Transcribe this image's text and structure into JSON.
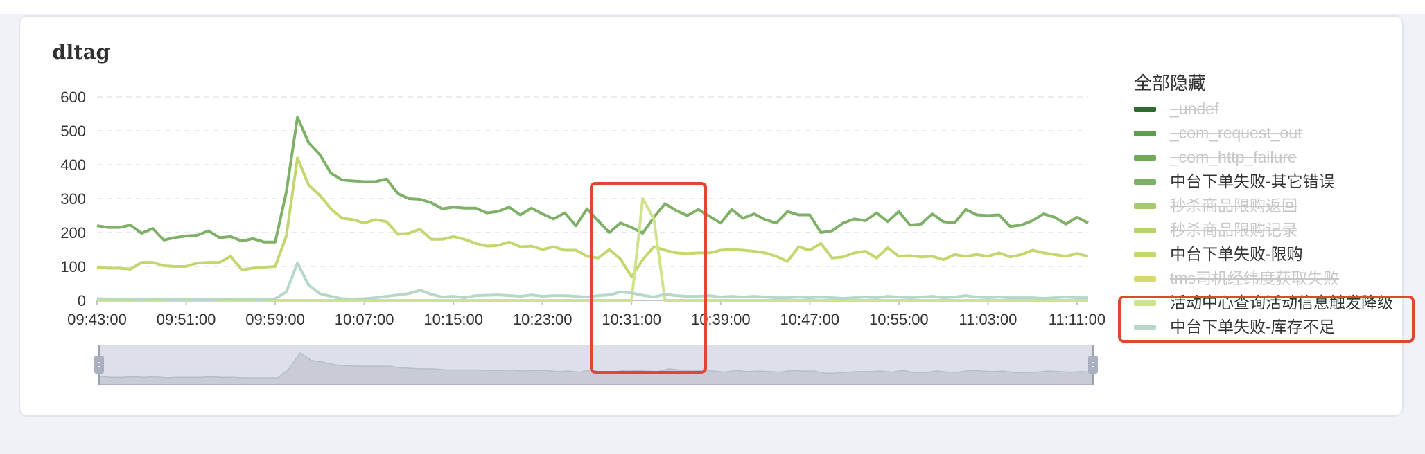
{
  "chart_data": {
    "type": "line",
    "title": "dltag",
    "xlabel": "",
    "ylabel": "",
    "ylim": [
      0,
      600
    ],
    "y_ticks": [
      0,
      100,
      200,
      300,
      400,
      500,
      600
    ],
    "grid": "horizontal dashed",
    "legend_position": "right",
    "legend_toggle_label": "全部隐藏",
    "x_tick_labels": [
      "09:43:00",
      "09:51:00",
      "09:59:00",
      "10:07:00",
      "10:15:00",
      "10:23:00",
      "10:31:00",
      "10:39:00",
      "10:47:00",
      "10:55:00",
      "11:03:00",
      "11:11:00"
    ],
    "x_tick_minutes": [
      0,
      8,
      16,
      24,
      32,
      40,
      48,
      56,
      64,
      72,
      80,
      88
    ],
    "x_range_minutes": [
      0,
      89
    ],
    "series": [
      {
        "name": "_undef",
        "color": "#2e6b2e",
        "visible": false,
        "values": []
      },
      {
        "name": "_com_request_out",
        "color": "#5b9e4c",
        "visible": false,
        "values": []
      },
      {
        "name": "_com_http_failure",
        "color": "#6eaa58",
        "visible": false,
        "values": []
      },
      {
        "name": "中台下单失败-其它错误",
        "color": "#7eb167",
        "visible": true,
        "values": [
          220,
          215,
          215,
          222,
          198,
          212,
          178,
          185,
          190,
          192,
          205,
          185,
          188,
          175,
          182,
          172,
          172,
          320,
          540,
          465,
          430,
          375,
          355,
          352,
          350,
          350,
          358,
          315,
          300,
          298,
          288,
          270,
          275,
          272,
          272,
          258,
          262,
          275,
          252,
          272,
          255,
          240,
          258,
          220,
          270,
          235,
          200,
          228,
          215,
          198,
          245,
          285,
          265,
          250,
          268,
          248,
          228,
          268,
          242,
          255,
          238,
          228,
          262,
          252,
          252,
          200,
          205,
          228,
          240,
          235,
          258,
          232,
          262,
          222,
          225,
          255,
          232,
          228,
          268,
          252,
          250,
          252,
          218,
          222,
          235,
          255,
          245,
          225,
          245,
          228
        ]
      },
      {
        "name": "秒杀商品限购返回",
        "color": "#a6c86e",
        "visible": false,
        "values": []
      },
      {
        "name": "秒杀商品限购记录",
        "color": "#b6d370",
        "visible": false,
        "values": []
      },
      {
        "name": "中台下单失败-限购",
        "color": "#c2d86e",
        "visible": true,
        "values": [
          98,
          95,
          95,
          92,
          112,
          112,
          102,
          100,
          100,
          110,
          112,
          112,
          130,
          90,
          95,
          98,
          100,
          190,
          420,
          340,
          310,
          270,
          242,
          238,
          228,
          238,
          232,
          195,
          198,
          210,
          180,
          180,
          188,
          180,
          168,
          160,
          162,
          172,
          158,
          160,
          150,
          158,
          148,
          148,
          130,
          125,
          150,
          122,
          70,
          120,
          158,
          148,
          140,
          138,
          140,
          140,
          148,
          150,
          148,
          145,
          140,
          130,
          115,
          158,
          148,
          168,
          125,
          128,
          140,
          145,
          125,
          155,
          130,
          132,
          128,
          130,
          120,
          135,
          130,
          135,
          130,
          140,
          128,
          135,
          148,
          140,
          135,
          130,
          138,
          130
        ]
      },
      {
        "name": "tms司机经纬度获取失败",
        "color": "#d6d972",
        "visible": false,
        "values": []
      },
      {
        "name": "活动中心查询活动信息触发降级",
        "color": "#cfe28c",
        "visible": true,
        "values": [
          0,
          0,
          0,
          0,
          0,
          0,
          0,
          0,
          0,
          0,
          0,
          0,
          0,
          0,
          0,
          0,
          0,
          0,
          0,
          0,
          0,
          0,
          0,
          0,
          0,
          0,
          0,
          0,
          0,
          0,
          0,
          0,
          0,
          0,
          0,
          0,
          0,
          0,
          0,
          0,
          0,
          0,
          0,
          0,
          0,
          0,
          0,
          0,
          0,
          300,
          240,
          0,
          0,
          0,
          0,
          0,
          0,
          0,
          0,
          0,
          0,
          0,
          0,
          0,
          0,
          0,
          0,
          0,
          0,
          0,
          0,
          0,
          0,
          0,
          0,
          0,
          0,
          0,
          0,
          0,
          0,
          0,
          0,
          0,
          0,
          0,
          0,
          0,
          0,
          0
        ]
      },
      {
        "name": "中台下单失败-库存不足",
        "color": "#b6d8c8",
        "visible": true,
        "values": [
          5,
          4,
          3,
          4,
          2,
          4,
          3,
          2,
          3,
          2,
          2,
          3,
          4,
          3,
          3,
          2,
          5,
          25,
          110,
          45,
          20,
          12,
          5,
          4,
          5,
          8,
          12,
          16,
          20,
          30,
          18,
          10,
          12,
          8,
          14,
          15,
          16,
          14,
          12,
          16,
          12,
          14,
          14,
          12,
          10,
          14,
          16,
          25,
          22,
          15,
          10,
          18,
          14,
          12,
          12,
          14,
          10,
          12,
          10,
          12,
          10,
          8,
          8,
          10,
          8,
          10,
          8,
          6,
          8,
          10,
          8,
          12,
          10,
          8,
          10,
          12,
          8,
          10,
          14,
          10,
          8,
          10,
          8,
          8,
          8,
          6,
          8,
          10,
          8,
          8
        ]
      }
    ]
  },
  "annotations": [
    {
      "label": "highlight-spike-region"
    },
    {
      "label": "highlight-legend-degrade"
    }
  ],
  "overview": {
    "values": [
      16,
      14,
      14,
      15,
      14,
      15,
      13,
      14,
      14,
      14,
      15,
      14,
      14,
      13,
      13,
      13,
      13,
      30,
      60,
      46,
      43,
      38,
      36,
      35,
      35,
      35,
      35,
      32,
      31,
      30,
      30,
      28,
      28,
      28,
      28,
      27,
      27,
      28,
      26,
      27,
      27,
      25,
      26,
      24,
      28,
      24,
      22,
      28,
      27,
      26,
      25,
      30,
      28,
      26,
      27,
      26,
      24,
      27,
      25,
      26,
      25,
      24,
      27,
      26,
      26,
      22,
      22,
      24,
      25,
      25,
      26,
      24,
      27,
      23,
      23,
      26,
      24,
      24,
      27,
      26,
      25,
      26,
      23,
      23,
      24,
      26,
      25,
      24,
      25,
      24
    ]
  }
}
